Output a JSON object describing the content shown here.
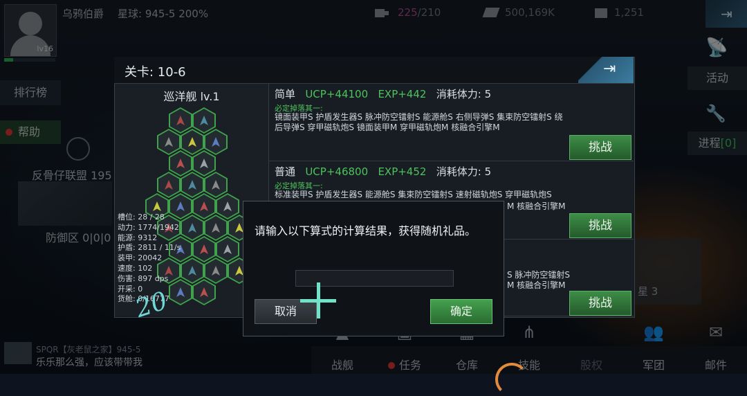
{
  "topbar": {
    "avatar_level": "lv16",
    "player_name": "乌鸦伯爵",
    "planet_label": "星球: 945-5",
    "planet_pct": "200%",
    "energy_current": "225",
    "energy_max": "/210",
    "money": "500,169K",
    "crystal": "1,251"
  },
  "left": {
    "rank": "排行榜",
    "help": "帮助",
    "alliance": "反骨仔联盟 195",
    "defense": "防御区 0|0|0"
  },
  "right": {
    "activity": "活动",
    "progress_label": "进程",
    "progress_count": "[0]",
    "panel_text": "星 3"
  },
  "chat": {
    "name": "SPQR【灰老鼠之家】945-5",
    "message": "乐乐那么强，应该带带我"
  },
  "nav": [
    "战舰",
    "任务",
    "仓库",
    "技能",
    "股权",
    "军团",
    "邮件"
  ],
  "stage": {
    "title": "关卡: 10-6",
    "ship_name": "巡洋舰 lv.1",
    "stats": [
      "槽位: 28 / 28",
      "动力: 1774/1942",
      "能源: 9312",
      "护盾: 2811 / 11/s",
      "装甲: 20042",
      "速度: 102",
      "伤害: 897 dps",
      "开采: 0",
      "货舱: 0/16777"
    ],
    "difficulties": [
      {
        "name": "简单",
        "ucp": "UCP+44100",
        "exp": "EXP+442",
        "cost": "消耗体力: 5",
        "drop_title": "必定掉落其一:",
        "items": "镜面装甲S 护盾发生器S 脉冲防空镭射S 能源舱S 右侧导弹S 集束防空镭射S 绕后导弹S 穿甲磁轨炮S 镜面装甲M 穿甲磁轨炮M 核融合引擎M",
        "button": "挑战"
      },
      {
        "name": "普通",
        "ucp": "UCP+46800",
        "exp": "EXP+452",
        "cost": "消耗体力: 5",
        "drop_title": "必定掉落其一:",
        "items": "标准装甲S 护盾发生器S 能源舱S 集束防空镭射S 速射磁轨炮S 穿甲磁轨炮S",
        "items_tail": "M 核融合引擎M",
        "button": "挑战"
      },
      {
        "items_tail1": "S 脉冲防空镭射S",
        "items_tail2": "M 核融合引擎M",
        "button": "挑战"
      }
    ]
  },
  "dialog": {
    "prompt": "请输入以下算式的计算结果，获得随机礼品。",
    "input_value": "",
    "cancel": "取消",
    "ok": "确定"
  },
  "overlay": {
    "scrawl": "20"
  }
}
